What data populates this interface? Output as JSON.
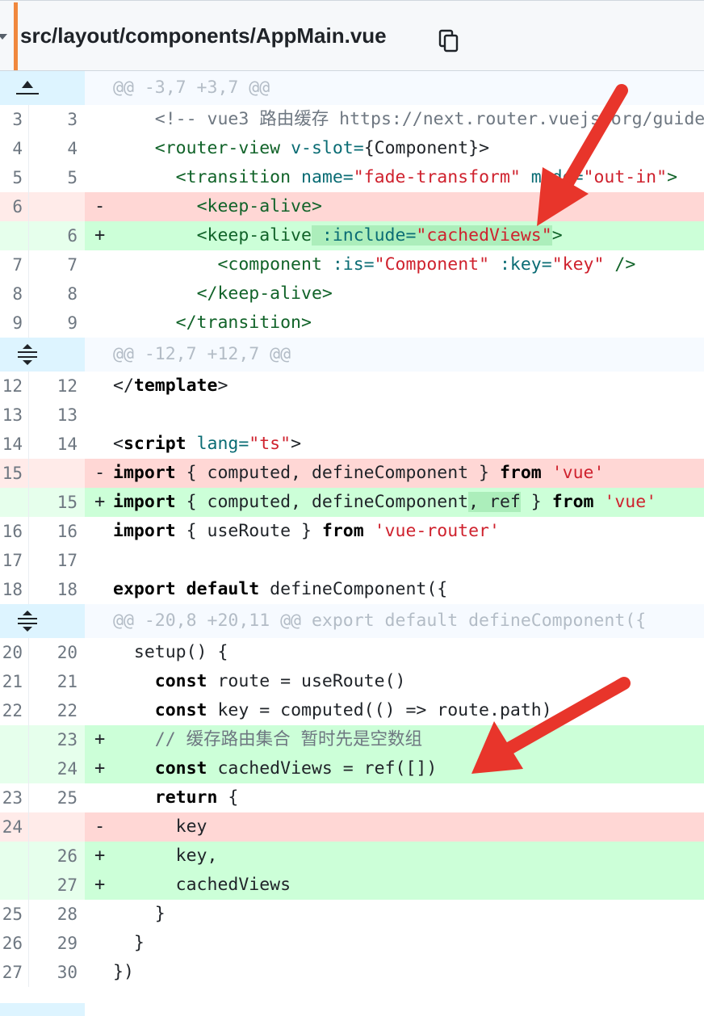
{
  "file": {
    "path": "src/layout/components/AppMain.vue"
  },
  "diff": {
    "hunk1": "@@ -3,7 +3,7 @@",
    "hunk2": "@@ -12,7 +12,7 @@",
    "hunk3": "@@ -20,8 +20,11 @@ export default defineComponent({",
    "rows": {
      "r3": {
        "old": "3",
        "new": "3"
      },
      "r4": {
        "old": "4",
        "new": "4"
      },
      "r5": {
        "old": "5",
        "new": "5"
      },
      "r6d": {
        "old": "6",
        "new": "",
        "marker": "-"
      },
      "r6a": {
        "old": "",
        "new": "6",
        "marker": "+"
      },
      "r7": {
        "old": "7",
        "new": "7"
      },
      "r8": {
        "old": "8",
        "new": "8"
      },
      "r9": {
        "old": "9",
        "new": "9"
      },
      "r12": {
        "old": "12",
        "new": "12"
      },
      "r13": {
        "old": "13",
        "new": "13"
      },
      "r14": {
        "old": "14",
        "new": "14"
      },
      "r15d": {
        "old": "15",
        "new": "",
        "marker": "-"
      },
      "r15a": {
        "old": "",
        "new": "15",
        "marker": "+"
      },
      "r16": {
        "old": "16",
        "new": "16"
      },
      "r17": {
        "old": "17",
        "new": "17"
      },
      "r18": {
        "old": "18",
        "new": "18"
      },
      "r20": {
        "old": "20",
        "new": "20"
      },
      "r21": {
        "old": "21",
        "new": "21"
      },
      "r22": {
        "old": "22",
        "new": "22"
      },
      "r23a": {
        "old": "",
        "new": "23",
        "marker": "+"
      },
      "r24a": {
        "old": "",
        "new": "24",
        "marker": "+"
      },
      "r25": {
        "old": "23",
        "new": "25"
      },
      "r24d": {
        "old": "24",
        "new": "",
        "marker": "-"
      },
      "r26a": {
        "old": "",
        "new": "26",
        "marker": "+"
      },
      "r27a": {
        "old": "",
        "new": "27",
        "marker": "+"
      },
      "r28": {
        "old": "25",
        "new": "28"
      },
      "r29": {
        "old": "26",
        "new": "29"
      },
      "r30": {
        "old": "27",
        "new": "30"
      }
    },
    "code": {
      "c3_indent": "    ",
      "c3_text": "<!-- vue3 路由缓存 https://next.router.vuejs.org/guide",
      "c4_indent": "    ",
      "c4_tag_open": "<router-view",
      "c4_attr": " v-slot=",
      "c4_rest": "{Component}>",
      "c5_indent": "      ",
      "c5_tag": "<transition",
      "c5_attr1": " name=",
      "c5_str1": "\"fade-transform\"",
      "c5_attr2": " mode=",
      "c5_str2": "\"out-in\"",
      "c5_end": ">",
      "c6d_indent": "        ",
      "c6d_tag": "<keep-alive>",
      "c6a_indent": "        ",
      "c6a_tag": "<keep-alive",
      "c6a_hl_attr": " :include=",
      "c6a_hl_str": "\"cachedViews\"",
      "c6a_end": ">",
      "c7_indent": "          ",
      "c7_tag": "<component",
      "c7_attr1": " :is=",
      "c7_str1": "\"Component\"",
      "c7_attr2": " :key=",
      "c7_str2": "\"key\"",
      "c7_end": " />",
      "c8_indent": "        ",
      "c8_tag": "</keep-alive>",
      "c9_indent": "      ",
      "c9_tag": "</transition>",
      "c12_open": "</",
      "c12_kw": "template",
      "c12_close": ">",
      "c14_open": "<",
      "c14_kw": "script",
      "c14_attr": " lang=",
      "c14_str": "\"ts\"",
      "c14_close": ">",
      "c15d_kw1": "import",
      "c15d_mid": " { computed, defineComponent } ",
      "c15d_kw2": "from",
      "c15d_str": " 'vue'",
      "c15a_kw1": "import",
      "c15a_mid1": " { computed, defineComponent",
      "c15a_hl": ", ref",
      "c15a_mid2": " } ",
      "c15a_kw2": "from",
      "c15a_str": " 'vue'",
      "c16_kw1": "import",
      "c16_mid": " { useRoute } ",
      "c16_kw2": "from",
      "c16_str": " 'vue-router'",
      "c18_kw1": "export",
      "c18_sp": " ",
      "c18_kw2": "default",
      "c18_rest": " defineComponent({",
      "c20": "  setup() {",
      "c21_indent": "    ",
      "c21_kw": "const",
      "c21_rest": " route = useRoute()",
      "c22_indent": "    ",
      "c22_kw": "const",
      "c22_rest": " key = computed(() => route.path)",
      "c23a_indent": "    ",
      "c23a_cm": "// 缓存路由集合 暂时先是空数组",
      "c24a_indent": "    ",
      "c24a_kw": "const",
      "c24a_rest": " cachedViews = ref([])",
      "c25_indent": "    ",
      "c25_kw": "return",
      "c25_rest": " {",
      "c24d": "      key",
      "c26a": "      key,",
      "c27a": "      cachedViews",
      "c28": "    }",
      "c29": "  }",
      "c30": "})"
    }
  },
  "colors": {
    "deletion_bg": "#ffd7d5",
    "addition_bg": "#ccffd8",
    "hunk_bg": "#ddf4ff",
    "arrow": "#e8352b",
    "accent_bar": "#f0883e"
  }
}
